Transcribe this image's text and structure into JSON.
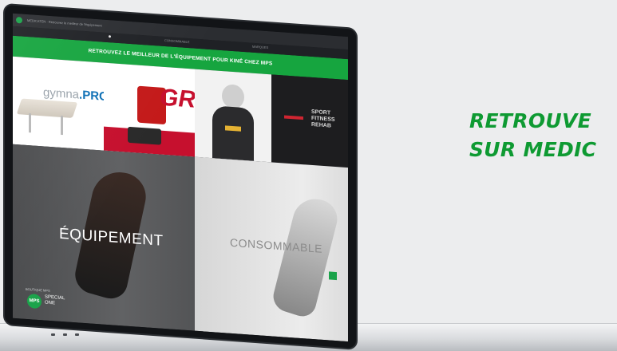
{
  "headline": {
    "line1": "RETROUVE",
    "line2": "SUR MEDIC",
    "color": "#0e9a32"
  },
  "browser": {
    "url_text": "MEDICATEN · Retrouvez le meilleur de l'équipement"
  },
  "site": {
    "nav_tabs": [
      "CONSOMMABLE",
      "MARQUES"
    ],
    "banner_text": "RETROUVEZ LE MEILLEUR DE L'ÉQUIPEMENT POUR KINÉ CHEZ MPS",
    "brand_color": "#16a53f",
    "brand_tiles": {
      "gymna": {
        "prefix": "gymna",
        "suffix": ".PRO"
      },
      "gr": "GR",
      "sport": [
        "SPORT",
        "FITNESS",
        "REHAB"
      ]
    },
    "sections": {
      "equipement": "ÉQUIPEMENT",
      "consommable": "CONSOMMABLE"
    },
    "mps": {
      "small_label": "BOUTIQUE MPS",
      "logo_text": "MPS",
      "special_line1": "SPECIAL",
      "special_line2": "ONE"
    }
  }
}
